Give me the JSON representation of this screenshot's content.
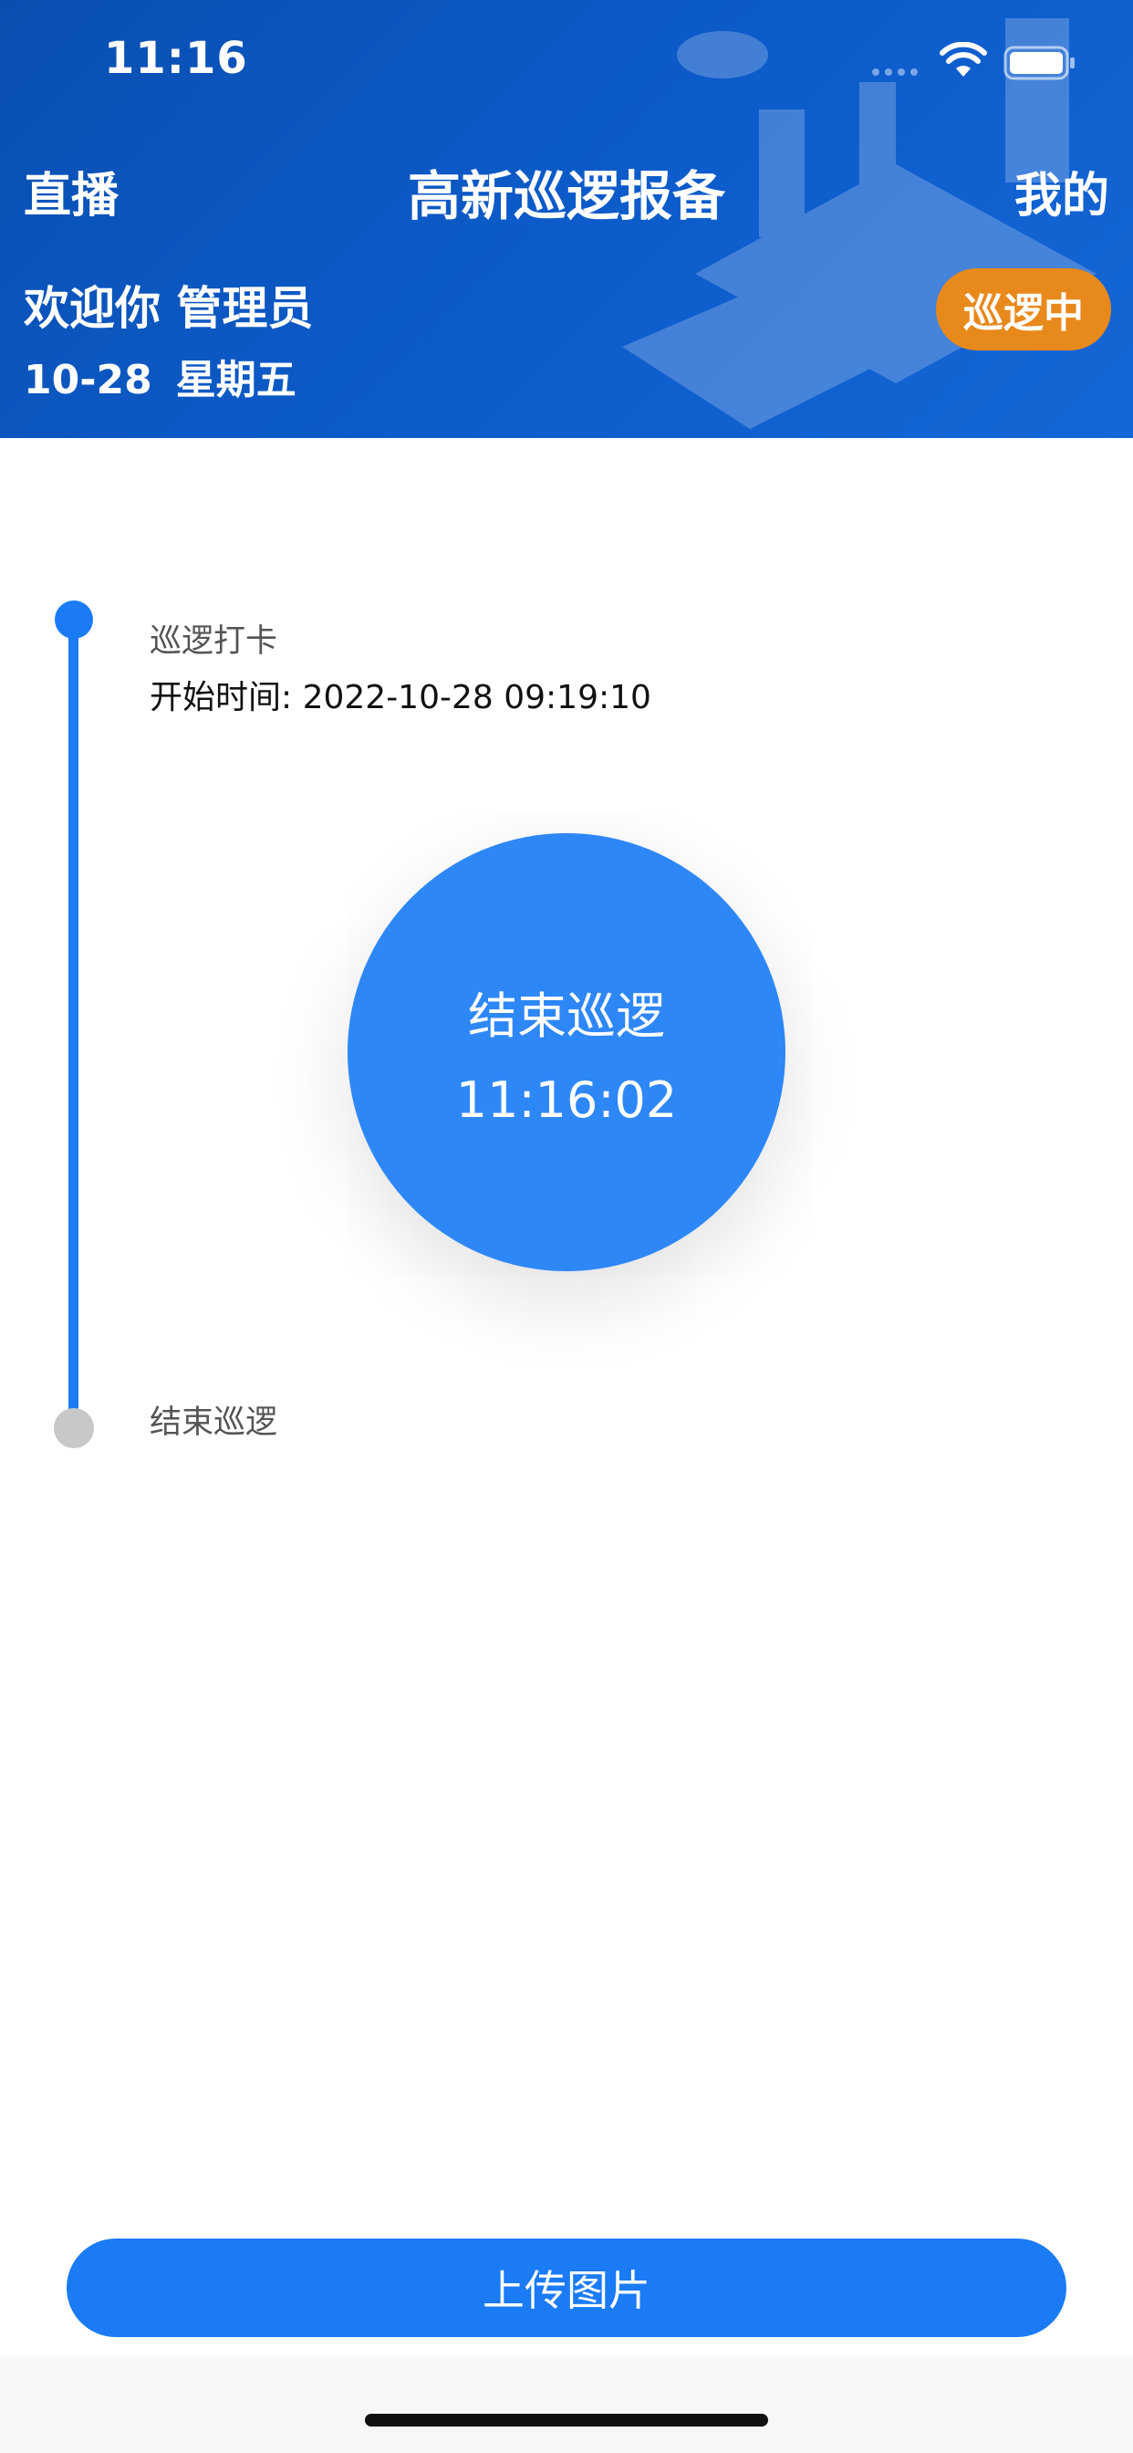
{
  "status_bar": {
    "time": "11:16",
    "icons": [
      "signal-icon",
      "wifi-icon",
      "battery-icon"
    ]
  },
  "nav": {
    "left_label": "直播",
    "title": "高新巡逻报备",
    "right_label": "我的"
  },
  "user": {
    "welcome": "欢迎你 管理员",
    "date": "10-28",
    "weekday": "星期五",
    "status_badge": "巡逻中"
  },
  "timeline": {
    "steps": [
      {
        "label": "巡逻打卡",
        "detail": "开始时间: 2022-10-28 09:19:10",
        "state": "done"
      },
      {
        "label": "结束巡逻",
        "state": "pending"
      }
    ]
  },
  "action_circle": {
    "label": "结束巡逻",
    "time": "11:16:02"
  },
  "upload_button": "上传图片",
  "colors": {
    "header": "#0d5ccc",
    "accent": "#1a7bf5",
    "circle": "#2e87f7",
    "badge": "#e8891c",
    "pending_dot": "#c8c8c8"
  }
}
